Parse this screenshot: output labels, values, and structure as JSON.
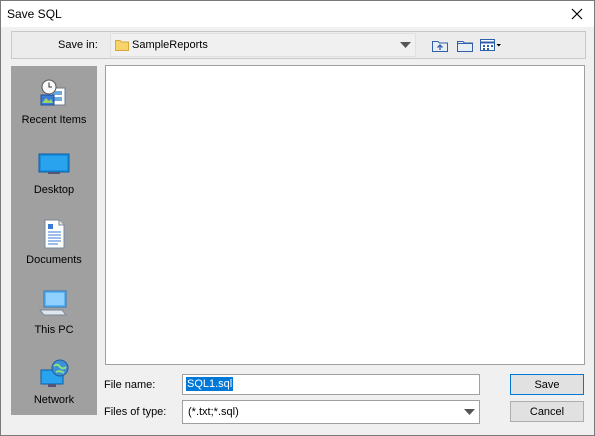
{
  "window": {
    "title": "Save SQL"
  },
  "toolbar": {
    "save_in_label": "Save in:",
    "save_in_value": "SampleReports",
    "icons": [
      "up-folder-icon",
      "new-folder-icon",
      "view-menu-icon"
    ]
  },
  "places": [
    {
      "label": "Recent Items",
      "icon": "recent-items-icon"
    },
    {
      "label": "Desktop",
      "icon": "desktop-icon"
    },
    {
      "label": "Documents",
      "icon": "documents-icon"
    },
    {
      "label": "This PC",
      "icon": "this-pc-icon"
    },
    {
      "label": "Network",
      "icon": "network-icon"
    }
  ],
  "form": {
    "file_name_label": "File name:",
    "file_name_value": "SQL1.sql",
    "file_type_label": "Files of type:",
    "file_type_value": "(*.txt;*.sql)"
  },
  "buttons": {
    "save": "Save",
    "cancel": "Cancel"
  },
  "colors": {
    "selection": "#0078d7",
    "places_bg": "#a0a0a0",
    "default_button_border": "#0078d7"
  }
}
